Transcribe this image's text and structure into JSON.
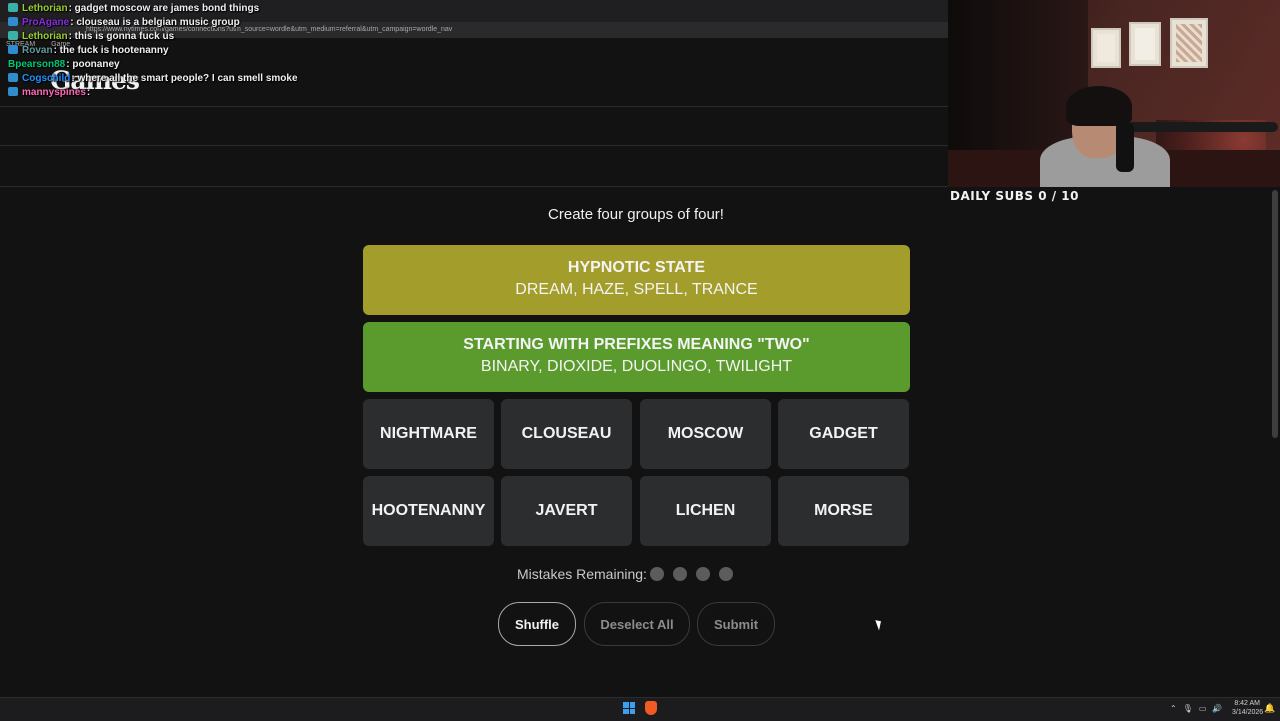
{
  "browser": {
    "url": "https://www.nytimes.com/games/connections?utm_source=wordle&utm_medium=referral&utm_campaign=wordle_nav",
    "bookmarks": [
      "STREAM",
      "Game"
    ],
    "logo_text": "Games"
  },
  "chat": [
    {
      "user": "Lethorian",
      "message": "gadget moscow are james bond things",
      "user_color": "#9acd32"
    },
    {
      "user": "ProAgane",
      "message": "clouseau is a belgian music group",
      "user_color": "#8a2be2"
    },
    {
      "user": "Lethorian",
      "message": "this is gonna fuck us",
      "user_color": "#9acd32"
    },
    {
      "user": "Rovan",
      "message": "the fuck is hootenanny",
      "user_color": "#5f9ea0"
    },
    {
      "user": "Bpearson88",
      "message": "poonaney",
      "user_color": "#00c878"
    },
    {
      "user": "Cogschild",
      "message": "where all the smart people? I can smell smoke",
      "user_color": "#1e90ff"
    },
    {
      "user": "mannyspines",
      "message": "",
      "user_color": "#ff69b4"
    }
  ],
  "stream": {
    "subs_label": "DAILY SUBS 0 / 10"
  },
  "game": {
    "instructions": "Create four groups of four!",
    "solved": [
      {
        "category": "HYPNOTIC STATE",
        "members": "DREAM, HAZE, SPELL, TRANCE",
        "color": "#a39d2c"
      },
      {
        "category": "STARTING WITH PREFIXES MEANING \"TWO\"",
        "members": "BINARY, DIOXIDE, DUOLINGO, TWILIGHT",
        "color": "#5b9b2d"
      }
    ],
    "tiles": [
      "NIGHTMARE",
      "CLOUSEAU",
      "MOSCOW",
      "GADGET",
      "HOOTENANNY",
      "JAVERT",
      "LICHEN",
      "MORSE"
    ],
    "mistakes_label": "Mistakes Remaining:",
    "mistakes_remaining": 4,
    "buttons": {
      "shuffle": "Shuffle",
      "deselect": "Deselect All",
      "submit": "Submit"
    }
  },
  "taskbar": {
    "time": "8:42 AM",
    "date": "3/14/2026"
  }
}
